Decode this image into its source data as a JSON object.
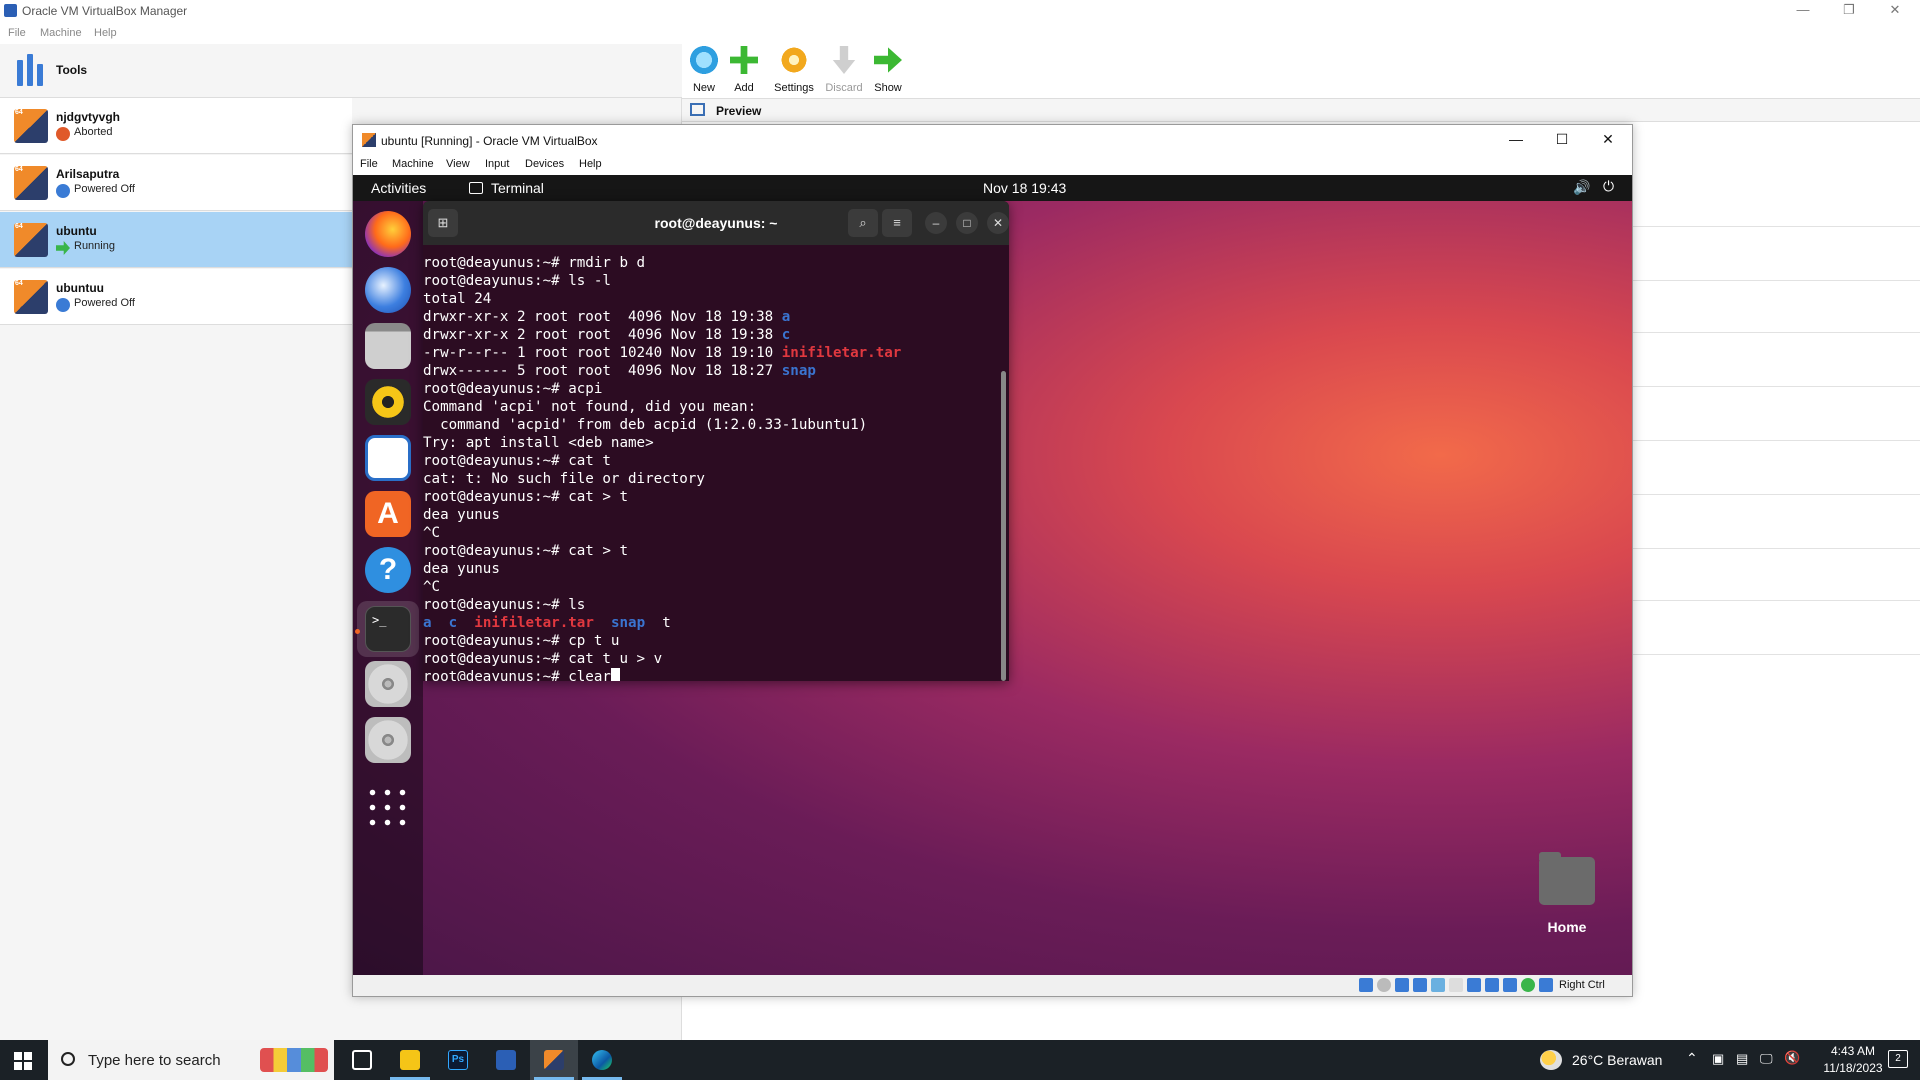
{
  "manager": {
    "title": "Oracle VM VirtualBox Manager",
    "menu": [
      "File",
      "Machine",
      "Help"
    ],
    "tools_label": "Tools",
    "vms": [
      {
        "name": "njdgvtyvgh",
        "state": "Aborted",
        "state_color": "#e05a2a"
      },
      {
        "name": "Arilsaputra",
        "state": "Powered Off",
        "state_color": "#3a7bd5"
      },
      {
        "name": "ubuntu",
        "state": "Running",
        "state_color": "#39b54a"
      },
      {
        "name": "ubuntuu",
        "state": "Powered Off",
        "state_color": "#3a7bd5"
      }
    ],
    "toolbar": {
      "new": "New",
      "add": "Add",
      "settings": "Settings",
      "discard": "Discard",
      "show": "Show"
    },
    "preview_label": "Preview"
  },
  "vm_window": {
    "title": "ubuntu [Running] - Oracle VM VirtualBox",
    "menu": [
      "File",
      "Machine",
      "View",
      "Input",
      "Devices",
      "Help"
    ],
    "status_host_key": "Right Ctrl"
  },
  "guest": {
    "activities": "Activities",
    "app_name": "Terminal",
    "datetime": "Nov 18  19:43",
    "home_label": "Home",
    "terminal": {
      "title": "root@deayunus: ~",
      "lines": [
        "root@deayunus:~# rmdir b d",
        "root@deayunus:~# ls -l",
        "total 24",
        "drwxr-xr-x 2 root root  4096 Nov 18 19:38 ",
        "drwxr-xr-x 2 root root  4096 Nov 18 19:38 ",
        "-rw-r--r-- 1 root root 10240 Nov 18 19:10 ",
        "drwx------ 5 root root  4096 Nov 18 18:27 ",
        "root@deayunus:~# acpi",
        "Command 'acpi' not found, did you mean:",
        "  command 'acpid' from deb acpid (1:2.0.33-1ubuntu1)",
        "Try: apt install <deb name>",
        "root@deayunus:~# cat t",
        "cat: t: No such file or directory",
        "root@deayunus:~# cat > t",
        "dea yunus",
        "^C",
        "root@deayunus:~# cat > t",
        "dea yunus",
        "^C",
        "root@deayunus:~# ls",
        "",
        "root@deayunus:~# cp t u",
        "root@deayunus:~# cat t u > v",
        "root@deayunus:~# clear"
      ],
      "ls_l_names": [
        "a",
        "c",
        "inifiletar.tar",
        "snap"
      ],
      "ls_names": [
        "a",
        "c",
        "inifiletar.tar",
        "snap",
        "t"
      ]
    }
  },
  "taskbar": {
    "search_placeholder": "Type here to search",
    "weather": "26°C  Berawan",
    "time": "4:43 AM",
    "date": "11/18/2023"
  },
  "colors": {
    "dir_blue": "#3a74d0",
    "archive_red": "#e0383f",
    "selection": "#a8d3f5"
  }
}
